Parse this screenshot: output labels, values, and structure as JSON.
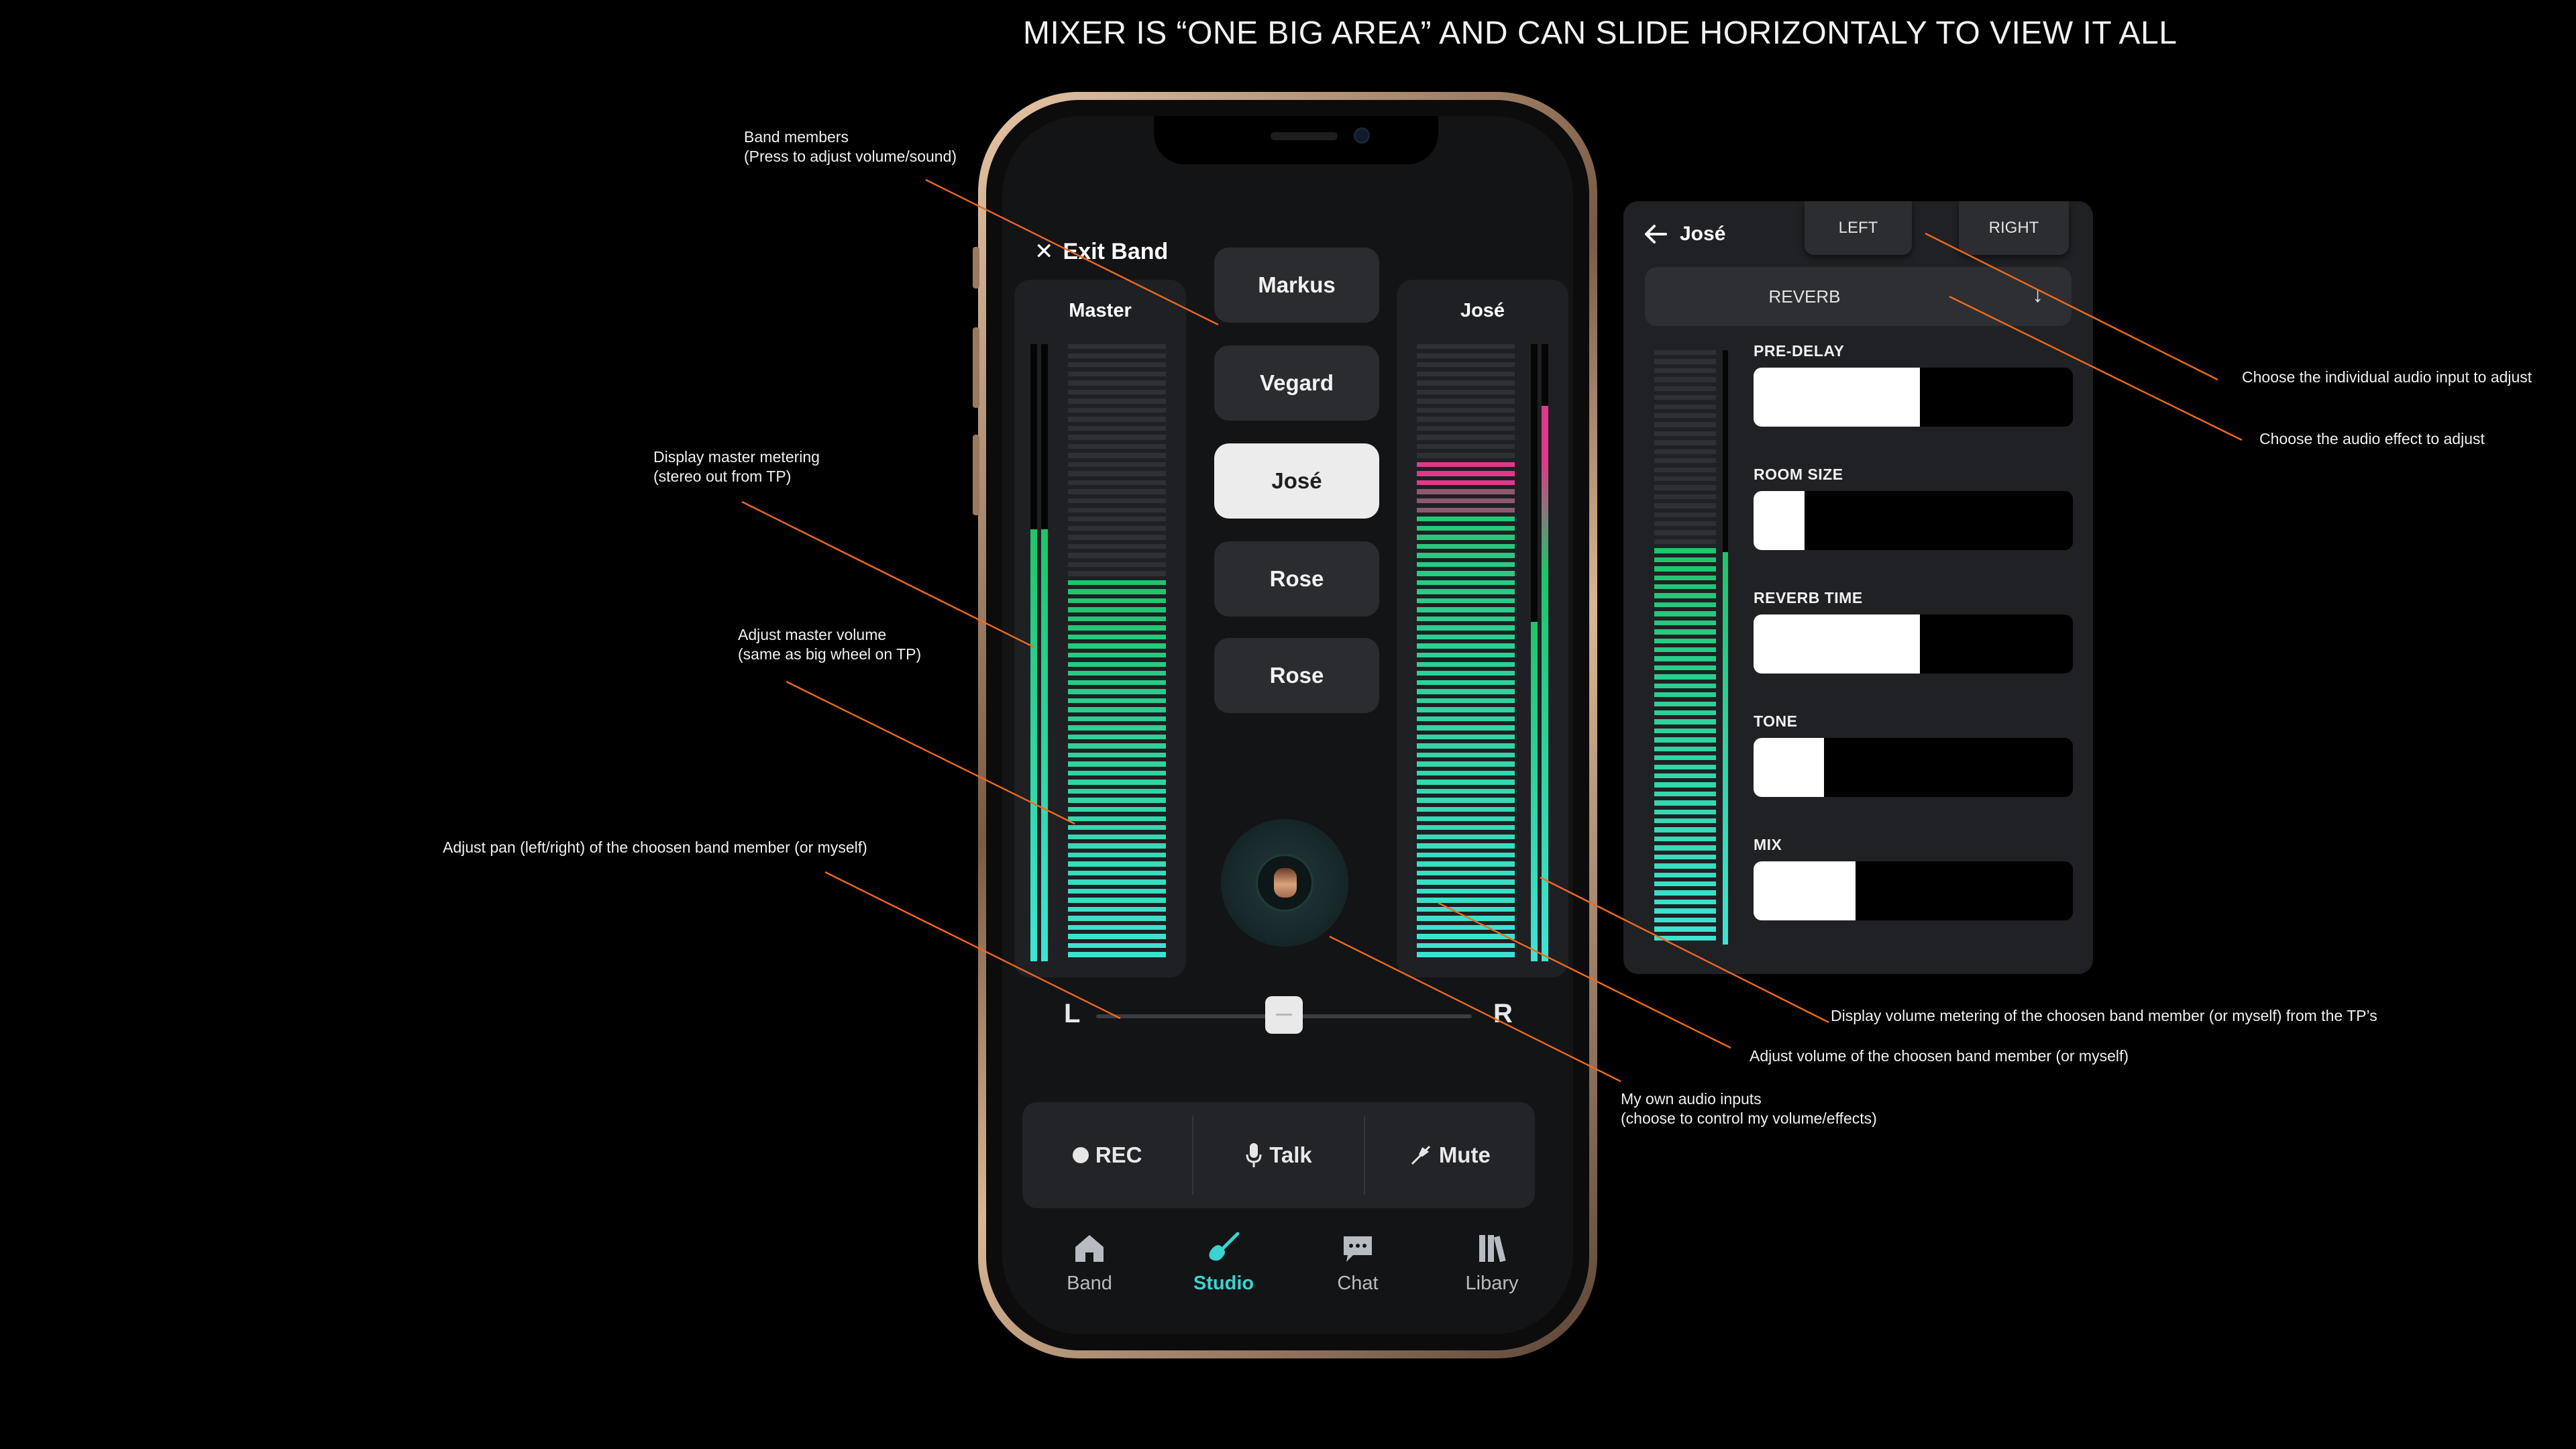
{
  "headline": "MIXER IS “ONE BIG AREA” AND CAN SLIDE HORIZONTALY TO VIEW IT ALL",
  "annotations": {
    "band_members": "Band members\n(Press to adjust volume/sound)",
    "master_metering": "Display master metering\n(stereo out from TP)",
    "master_volume": "Adjust master volume\n(same as big wheel on TP)",
    "pan": "Adjust pan (left/right) of the choosen band member (or myself)",
    "own_inputs": "My own audio inputs\n(choose to control my volume/effects)",
    "member_volume": "Adjust volume of the choosen band member (or myself)",
    "member_metering": "Display volume metering of the choosen band member (or myself) from the TP’s",
    "choose_input": "Choose the individual audio input to adjust",
    "choose_effect": "Choose the audio effect to adjust"
  },
  "app": {
    "exit_label": "Exit Band",
    "master": {
      "title": "Master",
      "level": 0.62,
      "thin_left": 0.7,
      "thin_right": 0.7
    },
    "selected_strip": {
      "title": "José",
      "level": 0.82,
      "thin_left": 0.55,
      "thin_right": 0.9
    },
    "members": [
      {
        "name": "Markus",
        "active": false
      },
      {
        "name": "Vegard",
        "active": false
      },
      {
        "name": "José",
        "active": true
      },
      {
        "name": "Rose",
        "active": false
      },
      {
        "name": "Rose",
        "active": false
      }
    ],
    "pan": {
      "left_label": "L",
      "right_label": "R",
      "position": 0.5
    },
    "controls": {
      "rec": "REC",
      "talk": "Talk",
      "mute": "Mute"
    },
    "tabs": [
      {
        "label": "Band",
        "icon": "home-icon",
        "active": false
      },
      {
        "label": "Studio",
        "icon": "guitar-icon",
        "active": true
      },
      {
        "label": "Chat",
        "icon": "chat-icon",
        "active": false
      },
      {
        "label": "Libary",
        "icon": "library-icon",
        "active": false
      }
    ]
  },
  "effects_panel": {
    "member": "José",
    "input_tabs": [
      "LEFT",
      "RIGHT"
    ],
    "selected_input": "LEFT",
    "effect": "REVERB",
    "meter_level": 0.68,
    "thin_level": 0.66,
    "params": [
      {
        "label": "PRE-DELAY",
        "value": 0.52
      },
      {
        "label": "ROOM SIZE",
        "value": 0.16
      },
      {
        "label": "REVERB TIME",
        "value": 0.52
      },
      {
        "label": "TONE",
        "value": 0.22
      },
      {
        "label": "MIX",
        "value": 0.32
      }
    ]
  },
  "colors": {
    "accent": "#3ad3cf",
    "meter_green": "#1fc46a",
    "meter_cyan": "#3fe3d6",
    "meter_pink": "#e0388a"
  }
}
